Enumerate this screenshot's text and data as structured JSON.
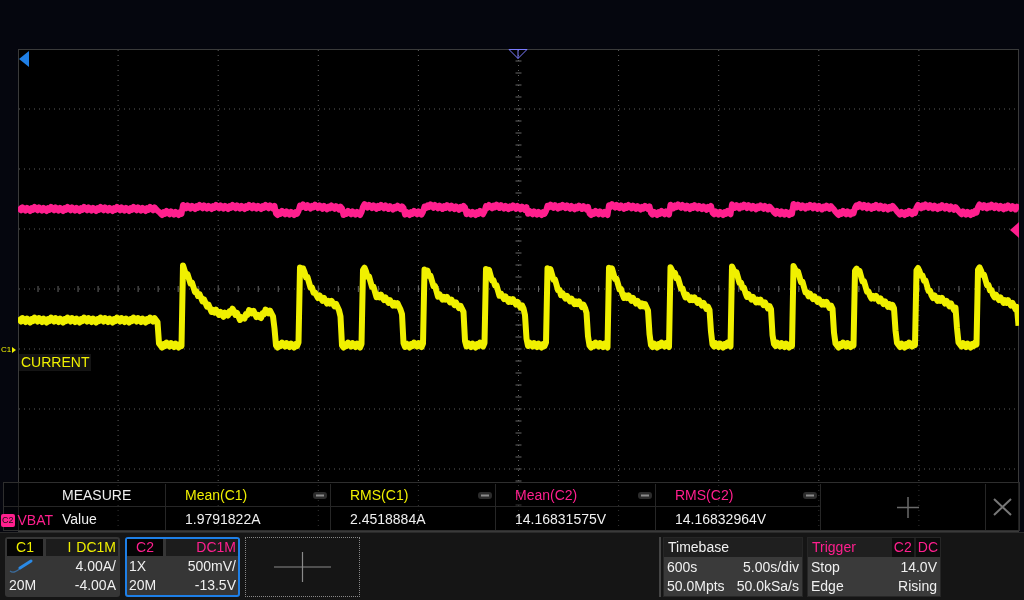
{
  "display": {
    "traces": [
      {
        "kind": "pointer",
        "marker": "C1",
        "label": "CURRENT",
        "color": "#f0f000"
      },
      {
        "kind": "badge",
        "marker": "C2",
        "label": "VBAT",
        "color": "#ff1f8e"
      }
    ]
  },
  "measure": {
    "title": "MEASURE",
    "row_label": "Value",
    "items": [
      {
        "name": "Mean(C1)",
        "value": "1.9791822A",
        "color": "#f0f000"
      },
      {
        "name": "RMS(C1)",
        "value": "2.4518884A",
        "color": "#f0f000"
      },
      {
        "name": "Mean(C2)",
        "value": "14.16831575V",
        "color": "#ff1f8e"
      },
      {
        "name": "RMS(C2)",
        "value": "14.16832964V",
        "color": "#ff1f8e"
      }
    ]
  },
  "channels": [
    {
      "name": "C1",
      "kind": "current",
      "unit": "I",
      "coupling": "DC1M",
      "scale": "4.00A/",
      "bandwidth": "20M",
      "offset": "-4.00A",
      "color": "#f0f000",
      "selected": false
    },
    {
      "name": "C2",
      "kind": "voltage",
      "probe": "1X",
      "coupling": "DC1M",
      "scale": "500mV/",
      "bandwidth": "20M",
      "offset": "-13.5V",
      "color": "#ff1f8e",
      "selected": true
    }
  ],
  "timebase": {
    "title": "Timebase",
    "delay": "600s",
    "scale": "5.00s/div",
    "memory_depth": "50.0Mpts",
    "sample_rate": "50.0kSa/s"
  },
  "trigger": {
    "title": "Trigger",
    "source": "C2",
    "coupling": "DC",
    "status": "Stop",
    "trigger_level": "14.0V",
    "mode": "Edge",
    "slope": "Rising"
  }
}
